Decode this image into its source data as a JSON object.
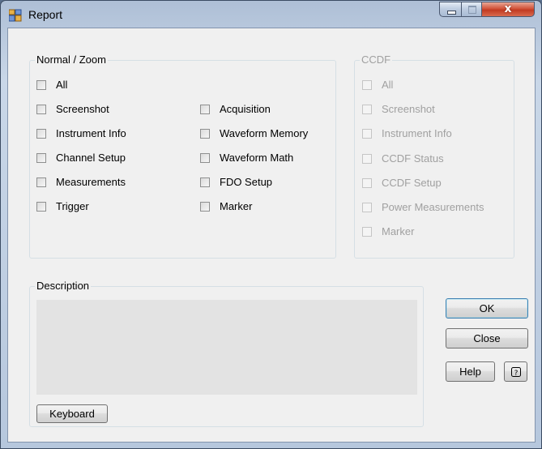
{
  "window": {
    "title": "Report",
    "close_glyph": "x"
  },
  "normal_zoom": {
    "legend": "Normal / Zoom",
    "all_label": "All",
    "left_items": [
      "Screenshot",
      "Instrument Info",
      "Channel Setup",
      "Measurements",
      "Trigger"
    ],
    "right_items": [
      "Acquisition",
      "Waveform Memory",
      "Waveform Math",
      "FDO Setup",
      "Marker"
    ]
  },
  "ccdf": {
    "legend": "CCDF",
    "items": [
      "All",
      "Screenshot",
      "Instrument Info",
      "CCDF Status",
      "CCDF Setup",
      "Power Measurements",
      "Marker"
    ]
  },
  "description": {
    "legend": "Description",
    "value": "",
    "keyboard_button": "Keyboard"
  },
  "buttons": {
    "ok": "OK",
    "close": "Close",
    "help": "Help",
    "context_help_icon": "context-help-icon"
  }
}
